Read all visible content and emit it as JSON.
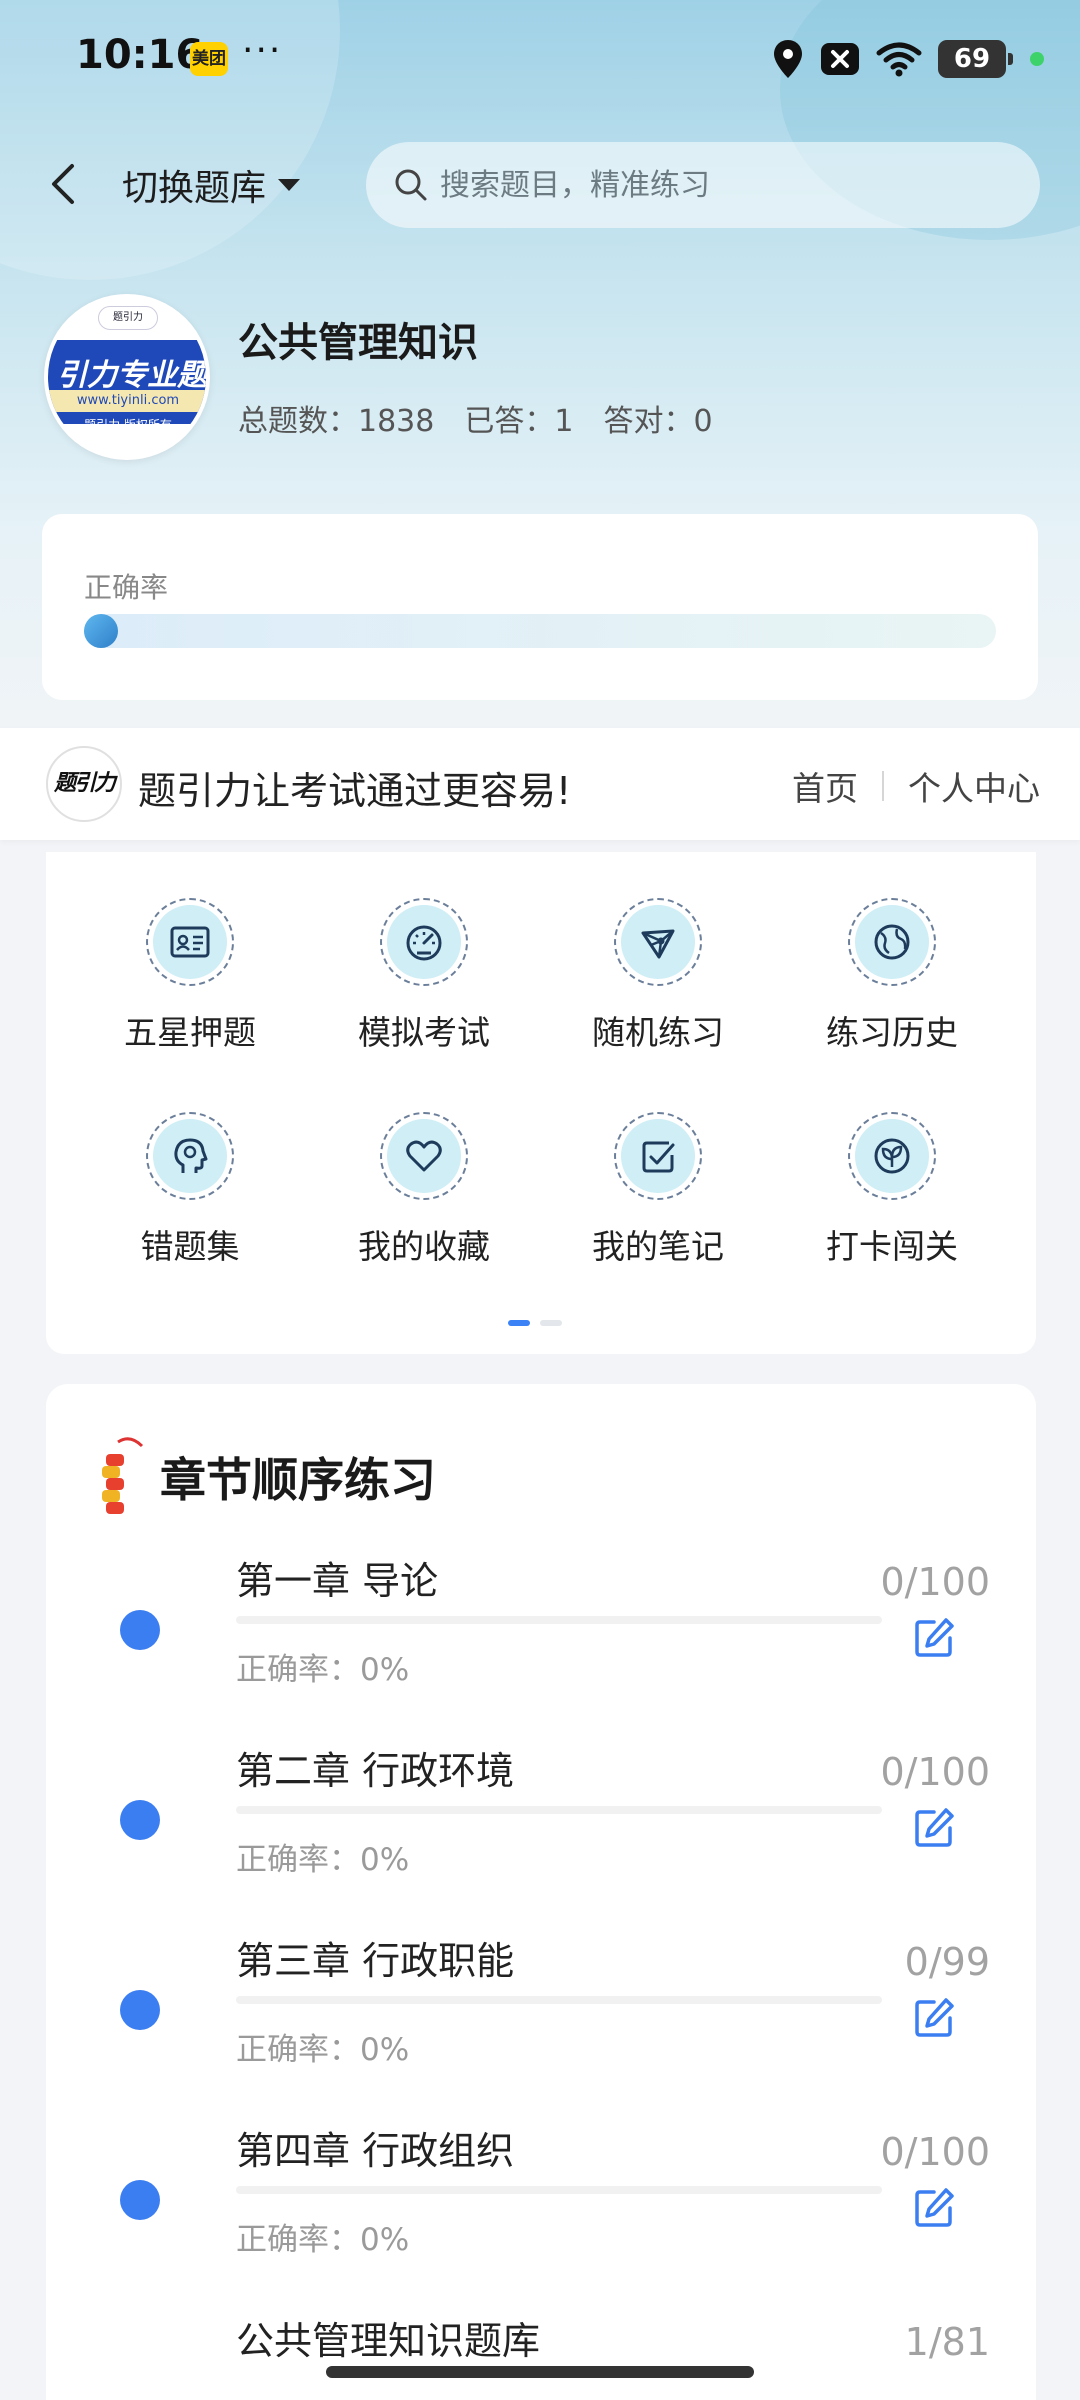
{
  "status_bar": {
    "time": "10:16",
    "app_badge": "美团",
    "more": "···",
    "battery": "69",
    "icons": [
      "location-icon",
      "notification-x-icon",
      "wifi-icon",
      "battery-icon"
    ]
  },
  "nav": {
    "switch_label": "切换题库",
    "search_placeholder": "搜索题目，精准练习"
  },
  "bank": {
    "name": "公共管理知识",
    "total": "总题数：1838",
    "answered": "已答：1",
    "correct": "答对：0",
    "logo": {
      "title": "引力专业题",
      "url": "www.tiyinli.com",
      "copyright": "题引力 版权所有",
      "top": "题引力"
    }
  },
  "accuracy": {
    "label": "正确率",
    "value_percent": 0
  },
  "banner": {
    "logo_text": "题引力",
    "slogan": "题引力让考试通过更容易!",
    "links": [
      "首页",
      "个人中心"
    ]
  },
  "features": [
    {
      "label": "五星押题",
      "icon": "id-card-icon"
    },
    {
      "label": "模拟考试",
      "icon": "speedometer-icon"
    },
    {
      "label": "随机练习",
      "icon": "network-icon"
    },
    {
      "label": "练习历史",
      "icon": "globe-icon"
    },
    {
      "label": "错题集",
      "icon": "head-icon"
    },
    {
      "label": "我的收藏",
      "icon": "heart-icon"
    },
    {
      "label": "我的笔记",
      "icon": "note-check-icon"
    },
    {
      "label": "打卡闯关",
      "icon": "leaf-icon"
    }
  ],
  "chapters": {
    "title": "章节顺序练习",
    "items": [
      {
        "title": "第一章 导论",
        "accuracy": "正确率：0%",
        "count": "0/100"
      },
      {
        "title": "第二章 行政环境",
        "accuracy": "正确率：0%",
        "count": "0/100"
      },
      {
        "title": "第三章 行政职能",
        "accuracy": "正确率：0%",
        "count": "0/99"
      },
      {
        "title": "第四章 行政组织",
        "accuracy": "正确率：0%",
        "count": "0/100"
      },
      {
        "title": "公共管理知识题库",
        "accuracy": "",
        "count": "1/81"
      }
    ]
  },
  "colors": {
    "accent": "#3b7ef2",
    "icon_bg": "#cfeef6",
    "muted_text": "#9a9a9a"
  }
}
